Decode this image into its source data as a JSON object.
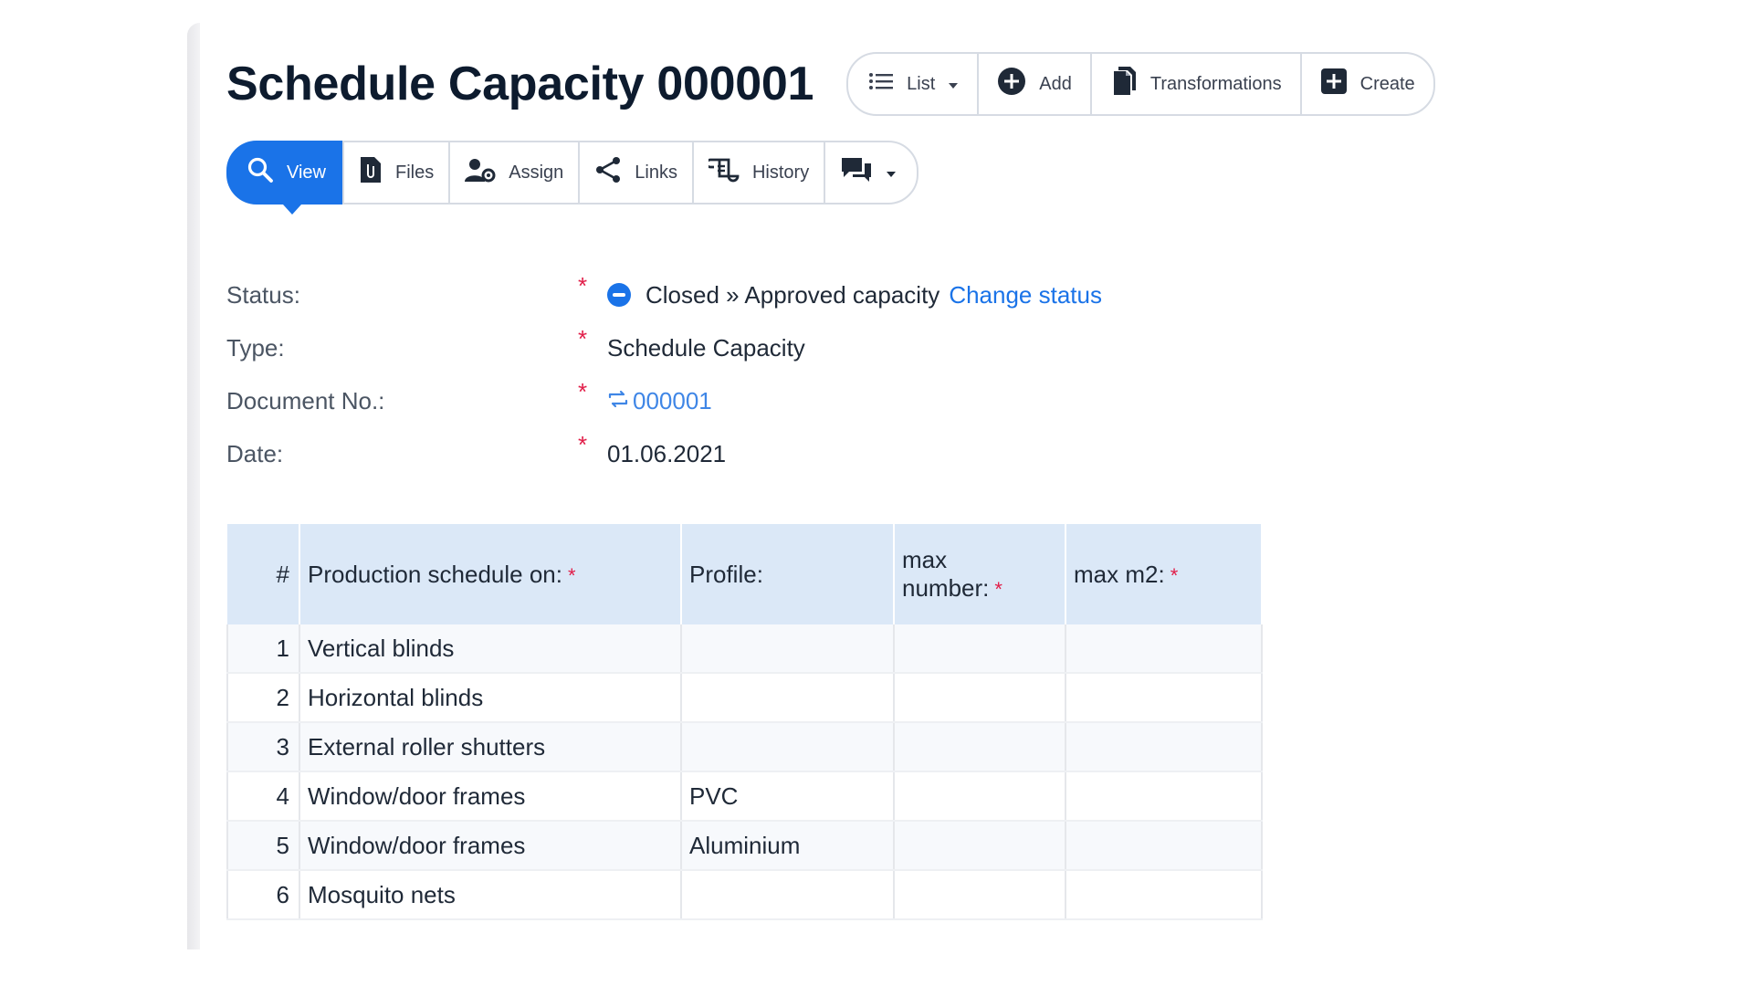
{
  "header": {
    "title": "Schedule Capacity 000001",
    "actions": [
      {
        "label": "List",
        "icon": "list-icon"
      },
      {
        "label": "Add",
        "icon": "plus-circle-icon"
      },
      {
        "label": "Transformations",
        "icon": "documents-icon"
      },
      {
        "label": "Create",
        "icon": "plus-square-icon"
      }
    ]
  },
  "tabs": [
    {
      "label": "View",
      "icon": "search-icon",
      "active": true
    },
    {
      "label": "Files",
      "icon": "file-clip-icon"
    },
    {
      "label": "Assign",
      "icon": "user-gear-icon"
    },
    {
      "label": "Links",
      "icon": "share-icon"
    },
    {
      "label": "History",
      "icon": "history-icon"
    },
    {
      "label": "",
      "icon": "comments-icon"
    }
  ],
  "fields": {
    "status": {
      "label": "Status:",
      "value": "Closed » Approved capacity",
      "change_link": "Change status"
    },
    "type": {
      "label": "Type:",
      "value": "Schedule Capacity"
    },
    "document_no": {
      "label": "Document No.:",
      "value": "000001"
    },
    "date": {
      "label": "Date:",
      "value": "01.06.2021"
    },
    "required_marker": "*"
  },
  "table": {
    "headers": {
      "num": "#",
      "production": "Production schedule on:",
      "profile": "Profile:",
      "max_number_line1": "max",
      "max_number_line2": "number:",
      "max_m2": "max m2:"
    },
    "rows": [
      {
        "num": "1",
        "production": "Vertical blinds",
        "profile": "",
        "max_number": "",
        "max_m2": ""
      },
      {
        "num": "2",
        "production": "Horizontal blinds",
        "profile": "",
        "max_number": "",
        "max_m2": ""
      },
      {
        "num": "3",
        "production": "External roller shutters",
        "profile": "",
        "max_number": "",
        "max_m2": ""
      },
      {
        "num": "4",
        "production": "Window/door frames",
        "profile": "PVC",
        "max_number": "",
        "max_m2": ""
      },
      {
        "num": "5",
        "production": "Window/door frames",
        "profile": "Aluminium",
        "max_number": "",
        "max_m2": ""
      },
      {
        "num": "6",
        "production": "Mosquito nets",
        "profile": "",
        "max_number": "",
        "max_m2": ""
      }
    ]
  },
  "colors": {
    "accent": "#1a73e8",
    "required": "#e11d48",
    "table_header_bg": "#dbe8f7",
    "title": "#0d1b2e"
  }
}
